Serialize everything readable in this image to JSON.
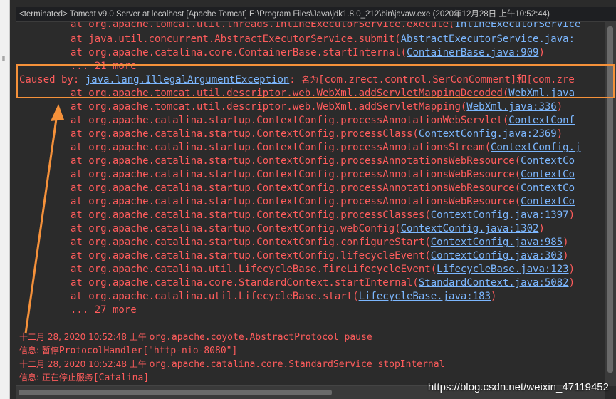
{
  "title_bar": {
    "text": "<terminated> Tomcat v9.0 Server at localhost [Apache Tomcat] E:\\Program Files\\Java\\jdk1.8.0_212\\bin\\javaw.exe (2020年12月28日 上午10:52:44)"
  },
  "console": {
    "lines": [
      {
        "prefix": "at org.apache.tomcat.util.threads.InlineExecutorService.execute(",
        "link": "InlineExecutorService"
      },
      {
        "prefix": "at java.util.concurrent.AbstractExecutorService.submit(",
        "link": "AbstractExecutorService.java:",
        "suffix": ""
      },
      {
        "prefix": "at org.apache.catalina.core.ContainerBase.startInternal(",
        "link": "ContainerBase.java:909",
        "suffix": ")"
      },
      {
        "prefix": "... 21 more"
      },
      {
        "caused_label": "Caused by: ",
        "link": "java.lang.IllegalArgumentException",
        "colon": ": ",
        "cn": "名为",
        "rest": "[com.zrect.control.SerConComment]和[com.zre"
      },
      {
        "prefix": "at org.apache.tomcat.util.descriptor.web.WebXml.addServletMappingDecoded(",
        "link": "WebXml.java"
      },
      {
        "prefix": "at org.apache.tomcat.util.descriptor.web.WebXml.addServletMapping(",
        "link": "WebXml.java:336",
        "suffix": ")"
      },
      {
        "prefix": "at org.apache.catalina.startup.ContextConfig.processAnnotationWebServlet(",
        "link": "ContextConf"
      },
      {
        "prefix": "at org.apache.catalina.startup.ContextConfig.processClass(",
        "link": "ContextConfig.java:2369",
        "suffix": ")"
      },
      {
        "prefix": "at org.apache.catalina.startup.ContextConfig.processAnnotationsStream(",
        "link": "ContextConfig.j"
      },
      {
        "prefix": "at org.apache.catalina.startup.ContextConfig.processAnnotationsWebResource(",
        "link": "ContextCo"
      },
      {
        "prefix": "at org.apache.catalina.startup.ContextConfig.processAnnotationsWebResource(",
        "link": "ContextCo"
      },
      {
        "prefix": "at org.apache.catalina.startup.ContextConfig.processAnnotationsWebResource(",
        "link": "ContextCo"
      },
      {
        "prefix": "at org.apache.catalina.startup.ContextConfig.processAnnotationsWebResource(",
        "link": "ContextCo"
      },
      {
        "prefix": "at org.apache.catalina.startup.ContextConfig.processClasses(",
        "link": "ContextConfig.java:1397",
        "suffix": ")"
      },
      {
        "prefix": "at org.apache.catalina.startup.ContextConfig.webConfig(",
        "link": "ContextConfig.java:1302",
        "suffix": ")"
      },
      {
        "prefix": "at org.apache.catalina.startup.ContextConfig.configureStart(",
        "link": "ContextConfig.java:985",
        "suffix": ")"
      },
      {
        "prefix": "at org.apache.catalina.startup.ContextConfig.lifecycleEvent(",
        "link": "ContextConfig.java:303",
        "suffix": ")"
      },
      {
        "prefix": "at org.apache.catalina.util.LifecycleBase.fireLifecycleEvent(",
        "link": "LifecycleBase.java:123",
        "suffix": ")"
      },
      {
        "prefix": "at org.apache.catalina.core.StandardContext.startInternal(",
        "link": "StandardContext.java:5082",
        "suffix": ")"
      },
      {
        "prefix": "at org.apache.catalina.util.LifecycleBase.start(",
        "link": "LifecycleBase.java:183",
        "suffix": ")"
      },
      {
        "prefix": "... 27 more"
      }
    ],
    "log_lines": [
      {
        "cn": "十二月 28, 2020 10:52:48 上午 ",
        "mono": "org.apache.coyote.AbstractProtocol pause"
      },
      {
        "cn": "信息: 暂停",
        "mono": "ProtocolHandler[\"http-nio-8080\"]"
      },
      {
        "cn": "十二月 28, 2020 10:52:48 上午 ",
        "mono": "org.apache.catalina.core.StandardService stopInternal"
      },
      {
        "cn": "信息: 正在停止服务",
        "mono": "[Catalina]"
      }
    ]
  },
  "watermark": "https://blog.csdn.net/weixin_47119452",
  "colors": {
    "background": "#2b2b2b",
    "error_text": "#ff5c5c",
    "link": "#7cb7ff",
    "highlight": "#f5913a"
  }
}
